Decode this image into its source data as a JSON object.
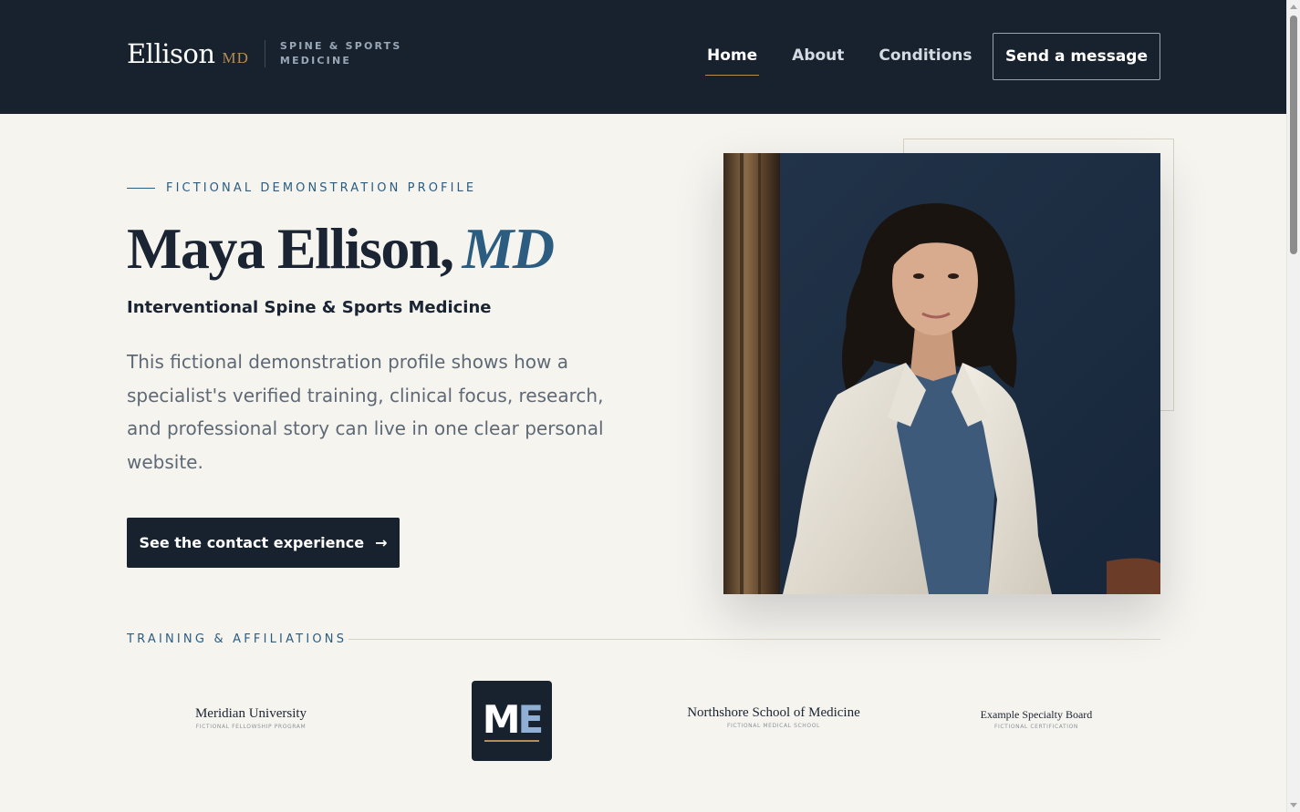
{
  "header": {
    "brand_name": "Ellison",
    "brand_suffix": "MD",
    "brand_tagline": "SPINE & SPORTS MEDICINE",
    "nav": [
      {
        "label": "Home",
        "active": true
      },
      {
        "label": "About",
        "active": false
      },
      {
        "label": "Conditions",
        "active": false
      }
    ],
    "cta_label": "Send a message"
  },
  "hero": {
    "eyebrow": "FICTIONAL DEMONSTRATION PROFILE",
    "name": "Maya Ellison,",
    "credential": "MD",
    "specialty": "Interventional Spine & Sports Medicine",
    "description": "This fictional demonstration profile shows how a specialist's verified training, clinical focus, research, and professional story can live in one clear personal website.",
    "cta_label": "See the contact experience",
    "cta_icon": "arrow-right-icon",
    "portrait": "portrait of a physician in a white coat"
  },
  "training": {
    "label": "TRAINING & AFFILIATIONS",
    "logos": [
      {
        "name": "Meridian University",
        "subtitle": "FICTIONAL FELLOWSHIP PROGRAM"
      },
      {
        "monogram_first": "M",
        "monogram_second": "E"
      },
      {
        "name": "Northshore School of Medicine",
        "subtitle": "FICTIONAL MEDICAL SCHOOL"
      },
      {
        "name": "Example Specialty Board",
        "subtitle": "FICTIONAL CERTIFICATION"
      }
    ]
  },
  "colors": {
    "navy": "#17222e",
    "accent_blue": "#2c5d80",
    "gold": "#b58d55",
    "background": "#f6f4ef"
  }
}
